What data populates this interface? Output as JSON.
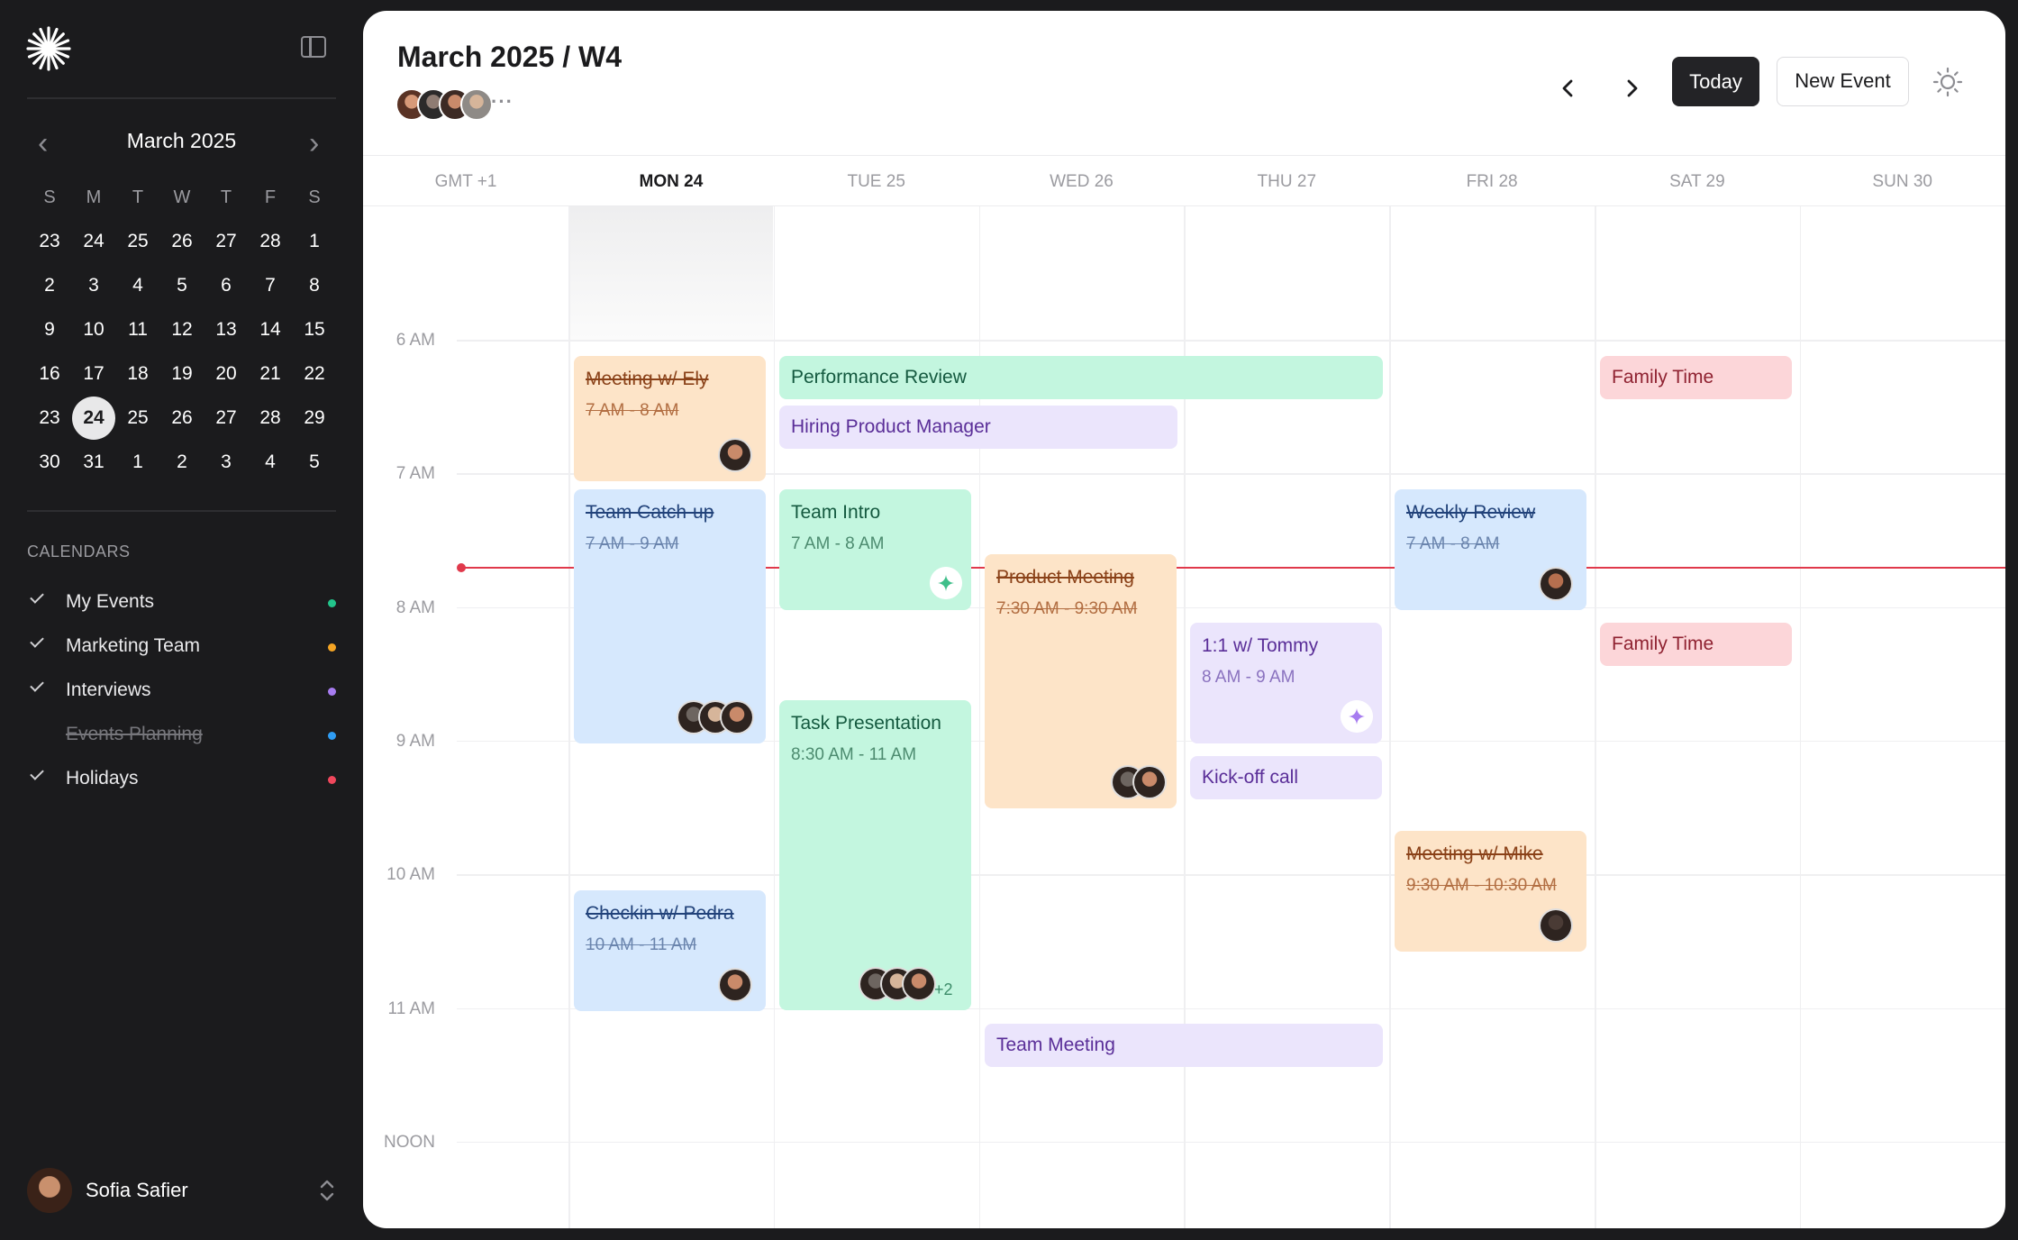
{
  "sidebar": {
    "mini_month": "March 2025",
    "weekday_initials": [
      "S",
      "M",
      "T",
      "W",
      "T",
      "F",
      "S"
    ],
    "weeks": [
      [
        "23",
        "24",
        "25",
        "26",
        "27",
        "28",
        "1"
      ],
      [
        "2",
        "3",
        "4",
        "5",
        "6",
        "7",
        "8"
      ],
      [
        "9",
        "10",
        "11",
        "12",
        "13",
        "14",
        "15"
      ],
      [
        "16",
        "17",
        "18",
        "19",
        "20",
        "21",
        "22"
      ],
      [
        "23",
        "24",
        "25",
        "26",
        "27",
        "28",
        "29"
      ],
      [
        "30",
        "31",
        "1",
        "2",
        "3",
        "4",
        "5"
      ]
    ],
    "selected_day": "24",
    "calendars_heading": "CALENDARS",
    "calendars": [
      {
        "label": "My Events",
        "checked": true,
        "color": "#22c58b"
      },
      {
        "label": "Marketing Team",
        "checked": true,
        "color": "#f5a524"
      },
      {
        "label": "Interviews",
        "checked": true,
        "color": "#a77cf0"
      },
      {
        "label": "Events Planning",
        "checked": false,
        "color": "#2f9df4"
      },
      {
        "label": "Holidays",
        "checked": true,
        "color": "#f0475c"
      }
    ],
    "user": {
      "name": "Sofia Safier"
    }
  },
  "header": {
    "title": "March 2025 / W4",
    "more_indicator": "···",
    "today_label": "Today",
    "new_event_label": "New Event"
  },
  "week": {
    "timezone": "GMT +1",
    "days": [
      {
        "label": "MON 24",
        "active": true
      },
      {
        "label": "TUE 25",
        "active": false
      },
      {
        "label": "WED 26",
        "active": false
      },
      {
        "label": "THU 27",
        "active": false
      },
      {
        "label": "FRI 28",
        "active": false
      },
      {
        "label": "SAT 29",
        "active": false
      },
      {
        "label": "SUN 30",
        "active": false
      }
    ],
    "hours": [
      "6 AM",
      "7 AM",
      "8 AM",
      "9 AM",
      "10 AM",
      "11 AM",
      "NOON"
    ]
  },
  "events": [
    {
      "title": "Meeting w/ Ely",
      "time": "7 AM - 8 AM",
      "color": "peach",
      "struck": true
    },
    {
      "title": "Performance Review",
      "time": "",
      "color": "green",
      "struck": false
    },
    {
      "title": "Hiring Product Manager",
      "time": "",
      "color": "purple",
      "struck": false
    },
    {
      "title": "Family Time",
      "time": "",
      "color": "pink",
      "struck": false
    },
    {
      "title": "Team Catch-up",
      "time": "7 AM - 9 AM",
      "color": "blue",
      "struck": true
    },
    {
      "title": "Team Intro",
      "time": "7 AM - 8 AM",
      "color": "green",
      "struck": false
    },
    {
      "title": "Weekly Review",
      "time": "7 AM - 8 AM",
      "color": "blue",
      "struck": true
    },
    {
      "title": "Product Meeting",
      "time": "7:30 AM - 9:30 AM",
      "color": "peach",
      "struck": true
    },
    {
      "title": "1:1 w/ Tommy",
      "time": "8 AM - 9 AM",
      "color": "purple",
      "struck": false
    },
    {
      "title": "Family Time",
      "time": "",
      "color": "pink",
      "struck": false
    },
    {
      "title": "Task Presentation",
      "time": "8:30 AM - 11 AM",
      "color": "green",
      "struck": false,
      "extra_count": "+2"
    },
    {
      "title": "Kick-off call",
      "time": "",
      "color": "purple",
      "struck": false
    },
    {
      "title": "Meeting w/ Mike",
      "time": "9:30 AM - 10:30 AM",
      "color": "peach",
      "struck": true
    },
    {
      "title": "Checkin w/ Pedra",
      "time": "10 AM - 11 AM",
      "color": "blue",
      "struck": true
    },
    {
      "title": "Team Meeting",
      "time": "",
      "color": "purple",
      "struck": false
    }
  ]
}
